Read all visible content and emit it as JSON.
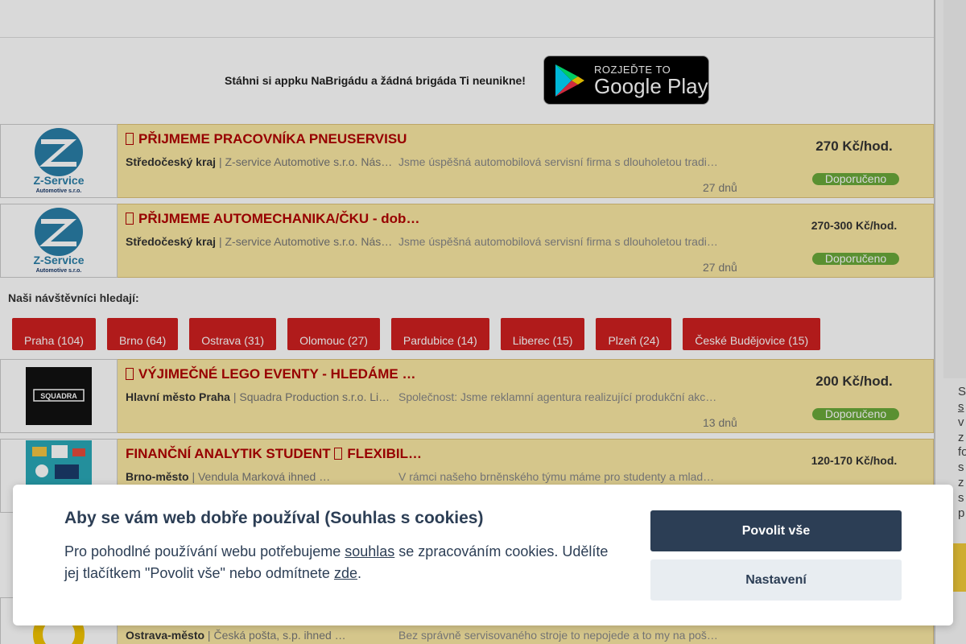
{
  "app_banner": {
    "promo_text": "Stáhni si appku NaBrigádu a žádná brigáda Ti neunikne!",
    "gplay_small": "ROZJEĎTE TO",
    "gplay_big": "Google Play"
  },
  "jobs": [
    {
      "title": "PŘIJMEME PRACOVNÍKA PNEUSERVISU",
      "region": "Středočeský kraj",
      "company": " | Z-service Automotive s.r.o. Nás…",
      "description": "Jsme úspěšná automobilová servisní firma s dlouholetou tradi…",
      "age": "27 dnů",
      "salary": "270 Kč/hod.",
      "badge": "Doporučeno",
      "logo_line1": "Z-Service",
      "logo_line2": "Automotive s.r.o."
    },
    {
      "title": "PŘIJMEME AUTOMECHANIKA/ČKU - dob…",
      "region": "Středočeský kraj",
      "company": " | Z-service Automotive s.r.o. Nás…",
      "description": "Jsme úspěšná automobilová servisní firma s dlouholetou tradi…",
      "age": "27 dnů",
      "salary": "270-300 Kč/hod.",
      "badge": "Doporučeno",
      "logo_line1": "Z-Service",
      "logo_line2": "Automotive s.r.o."
    },
    {
      "title": "VÝJIMEČNÉ LEGO EVENTY - HLEDÁME …",
      "region": "Hlavní město Praha",
      "company": " | Squadra Production s.r.o. Li…",
      "description": "Společnost: Jsme reklamní agentura realizující produkční akc…",
      "age": "13 dnů",
      "salary": "200 Kč/hod.",
      "badge": "Doporučeno",
      "logo_text": "SQUADRA"
    },
    {
      "title": "FINANČNÍ ANALYTIK STUDENT",
      "title_suffix": "FLEXIBIL…",
      "region": "Brno-město",
      "company": " | Vendula Marková ihned …",
      "description": "V rámci našeho brněnského týmu máme pro studenty a mlad…",
      "salary": "120-170 Kč/hod."
    },
    {
      "region": "Ostrava-město",
      "company": " | Česká pošta, s.p. ihned …",
      "description": "Bez správně servisovaného stroje to nepojede a to my na poš…"
    }
  ],
  "visitors": {
    "label": "Naši návštěvníci hledají:",
    "cities": [
      "Praha (104)",
      "Brno (64)",
      "Ostrava (31)",
      "Olomouc (27)",
      "Pardubice (14)",
      "Liberec (15)",
      "Plzeň (24)",
      "České Budějovice (15)"
    ]
  },
  "right_panel": {
    "fragments": [
      "S",
      "s",
      "v",
      "z",
      "fo",
      "s",
      "z",
      "s",
      "p"
    ]
  },
  "cookie": {
    "title": "Aby se vám web dobře používal (Souhlas s cookies)",
    "text_1": "Pro pohodlné používání webu potřebujeme ",
    "link_1": "souhlas",
    "text_2": " se zpracováním cookies. Udělíte jej tlačítkem \"Povolit vše\" nebo odmítnete ",
    "link_2": "zde",
    "text_3": ".",
    "allow_all": "Povolit vše",
    "settings": "Nastavení"
  },
  "colors": {
    "job_bg": "#fbe9a4",
    "title_red": "#b20000",
    "badge_green": "#6aaa3a",
    "city_red": "#cf2020",
    "cookie_navy": "#2c3e55"
  }
}
